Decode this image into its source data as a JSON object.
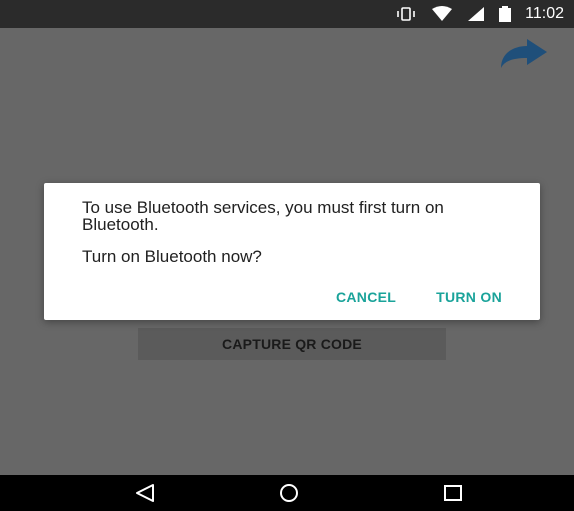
{
  "status_bar": {
    "time": "11:02",
    "icons": [
      "vibrate-icon",
      "wifi-icon",
      "signal-icon",
      "battery-icon"
    ]
  },
  "screen": {
    "share_icon": "share-icon",
    "capture_label": "CAPTURE QR CODE"
  },
  "dialog": {
    "message": "To use Bluetooth services, you must first turn on Bluetooth.",
    "question": "Turn on Bluetooth now?",
    "cancel_label": "CANCEL",
    "turn_on_label": "TURN ON",
    "accent_color": "#1aa39a"
  },
  "nav_bar": {
    "icons": [
      "back-icon",
      "home-icon",
      "recents-icon"
    ]
  }
}
